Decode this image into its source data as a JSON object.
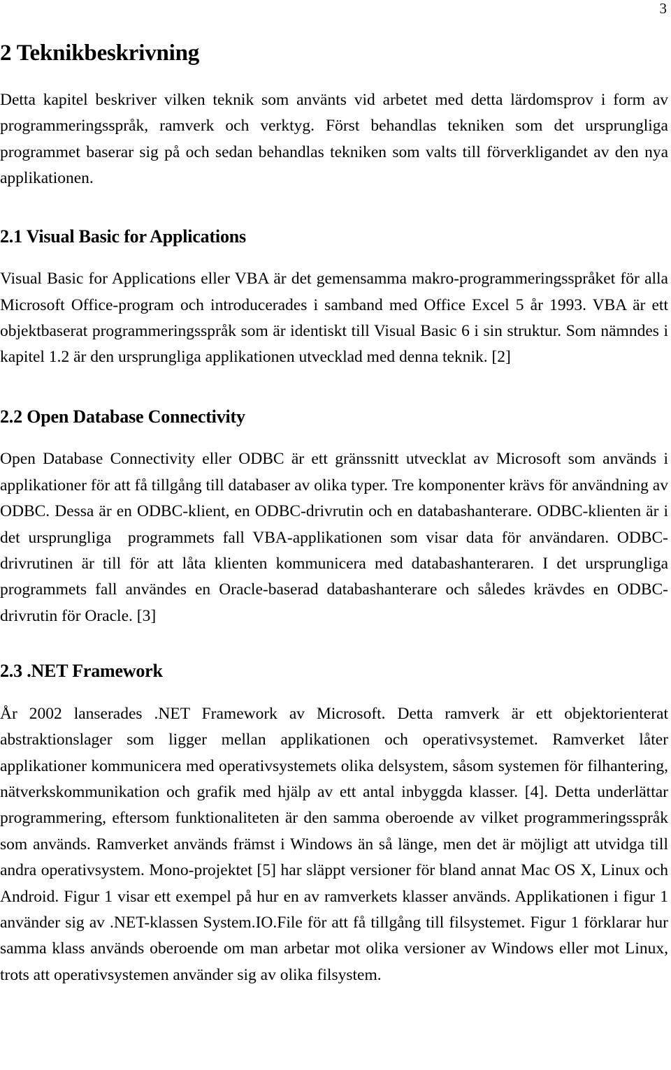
{
  "page": {
    "number": "3"
  },
  "chapter": {
    "title": "2 Teknikbeskrivning",
    "intro": "Detta kapitel beskriver vilken teknik som använts vid arbetet med detta lärdomsprov i form av programmeringsspråk, ramverk och verktyg. Först behandlas tekniken som det ursprungliga programmet baserar sig på och sedan behandlas tekniken som valts till förverkligandet av den nya applikationen."
  },
  "sections": [
    {
      "heading": "2.1 Visual Basic for Applications",
      "body": "Visual Basic for Applications eller VBA är det gemensamma makro-programmeringsspråket för alla Microsoft Office-program och introducerades i samband med Office Excel 5 år 1993. VBA är ett objektbaserat programmeringsspråk som är identiskt till Visual Basic 6 i sin struktur. Som nämndes i kapitel 1.2 är den ursprungliga applikationen utvecklad med denna teknik. [2]"
    },
    {
      "heading": "2.2 Open Database Connectivity",
      "body": "Open Database Connectivity eller ODBC är ett gränssnitt utvecklat av Microsoft som används i applikationer för att få tillgång till databaser av olika typer. Tre komponenter krävs för användning av ODBC. Dessa är en ODBC-klient, en ODBC-drivrutin och en databashanterare. ODBC-klienten är i det ursprungliga  programmets fall VBA-applikationen som visar data för användaren. ODBC-drivrutinen är till för att låta klienten kommunicera med databashanteraren. I det ursprungliga programmets fall användes en Oracle-baserad databashanterare och således krävdes en ODBC-drivrutin för Oracle. [3]"
    },
    {
      "heading": "2.3 .NET Framework",
      "body": "År 2002 lanserades .NET Framework av Microsoft. Detta ramverk är ett objektorienterat abstraktionslager som ligger mellan applikationen och operativsystemet. Ramverket låter applikationer kommunicera med operativsystemets olika delsystem, såsom systemen för filhantering, nätverkskommunikation och grafik med hjälp av ett antal inbyggda klasser. [4]. Detta underlättar programmering, eftersom funktionaliteten är den samma oberoende av vilket programmeringsspråk som används. Ramverket används främst i Windows än så länge, men det är möjligt att utvidga till andra operativsystem. Mono-projektet [5] har släppt versioner för bland annat Mac OS X, Linux och Android. Figur 1 visar ett exempel på hur en av ramverkets klasser används. Applikationen i figur 1 använder sig av .NET-klassen System.IO.File för att få tillgång till filsystemet. Figur 1 förklarar hur samma klass används oberoende om man arbetar mot olika versioner av Windows eller mot Linux, trots att operativsystemen använder sig av olika filsystem."
    }
  ]
}
